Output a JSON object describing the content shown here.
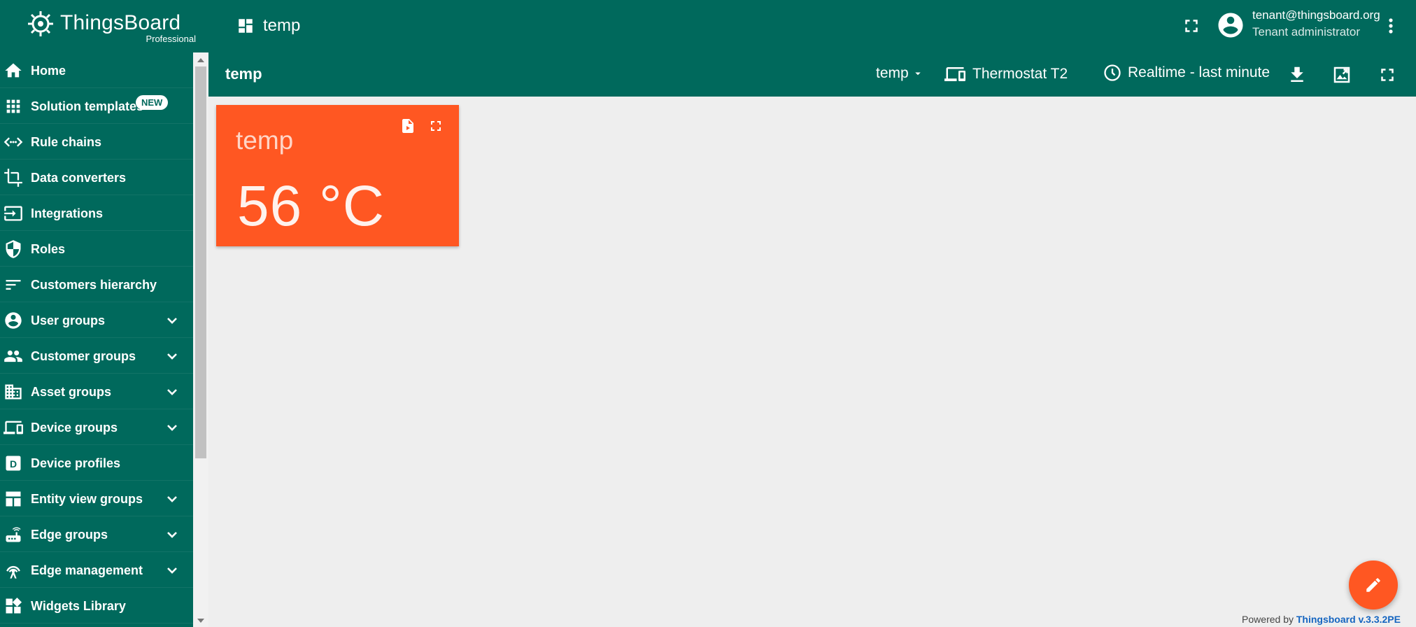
{
  "app": {
    "name": "ThingsBoard",
    "edition": "Professional"
  },
  "header": {
    "breadcrumb": "temp",
    "user_email": "tenant@thingsboard.org",
    "user_role": "Tenant administrator"
  },
  "sidebar": {
    "items": [
      {
        "label": "Home",
        "icon": "home-icon"
      },
      {
        "label": "Solution templates",
        "icon": "apps-grid-icon",
        "badge": "NEW"
      },
      {
        "label": "Rule chains",
        "icon": "code-arrows-icon"
      },
      {
        "label": "Data converters",
        "icon": "crop-icon"
      },
      {
        "label": "Integrations",
        "icon": "input-icon"
      },
      {
        "label": "Roles",
        "icon": "shield-icon"
      },
      {
        "label": "Customers hierarchy",
        "icon": "sort-lines-icon"
      },
      {
        "label": "User groups",
        "icon": "account-circle-icon",
        "expandable": true
      },
      {
        "label": "Customer groups",
        "icon": "people-icon",
        "expandable": true
      },
      {
        "label": "Asset groups",
        "icon": "building-icon",
        "expandable": true
      },
      {
        "label": "Device groups",
        "icon": "devices-icon",
        "expandable": true
      },
      {
        "label": "Device profiles",
        "icon": "profile-d-icon"
      },
      {
        "label": "Entity view groups",
        "icon": "dashboard-view-icon",
        "expandable": true
      },
      {
        "label": "Edge groups",
        "icon": "router-icon",
        "expandable": true
      },
      {
        "label": "Edge management",
        "icon": "antenna-icon",
        "expandable": true
      },
      {
        "label": "Widgets Library",
        "icon": "widgets-icon"
      }
    ]
  },
  "dashboard": {
    "title": "temp",
    "state": "temp",
    "entity": "Thermostat T2",
    "timewindow": "Realtime - last minute"
  },
  "widget": {
    "title": "temp",
    "value": "56 °C"
  },
  "footer": {
    "prefix": "Powered by",
    "link": "Thingsboard v.3.3.2PE"
  },
  "colors": {
    "primary": "#00695c",
    "accent": "#ff5722",
    "background": "#eeeeee"
  }
}
